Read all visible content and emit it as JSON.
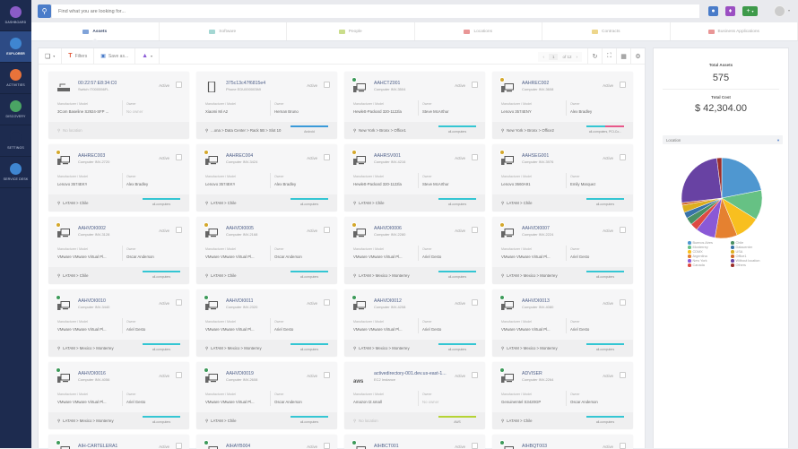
{
  "sidebar": {
    "items": [
      {
        "label": "Dashboard",
        "icon": "gauge-icon",
        "color": "#8b5cc7"
      },
      {
        "label": "Explorer",
        "icon": "globe-icon",
        "color": "#3f86d1",
        "active": true
      },
      {
        "label": "Activities",
        "icon": "clock-icon",
        "color": "#e8733a"
      },
      {
        "label": "Discovery",
        "icon": "list-icon",
        "color": "#4aa564"
      },
      {
        "label": "Settings",
        "icon": "gears-icon",
        "color": "#1d2b4f"
      },
      {
        "label": "Service Desk",
        "icon": "service-desk-icon",
        "color": "#3f86d1"
      }
    ]
  },
  "header": {
    "search_placeholder": "Find what you are looking for..."
  },
  "tabs": [
    {
      "label": "Assets",
      "active": true,
      "color": "#4a7cc9"
    },
    {
      "label": "Software",
      "color": "#7ec6c0"
    },
    {
      "label": "People",
      "color": "#b3cf5a"
    },
    {
      "label": "Locations",
      "color": "#e06a6a"
    },
    {
      "label": "Contracts",
      "color": "#e6c45a"
    },
    {
      "label": "Business Applications",
      "color": "#e06a6a"
    }
  ],
  "toolbar": {
    "filters": "Filters",
    "save_as": "Save as...",
    "pager": {
      "current": "1",
      "of": "of 12"
    }
  },
  "labels": {
    "active": "Active",
    "manufacturer": "Manufacturer / Model",
    "owner": "Owner"
  },
  "cards": [
    {
      "name": "00:22:57:E8:34:C0",
      "sub": "Switch IT000556FL",
      "type": "switch",
      "badge": "",
      "model": "3Com Baseline S2924-SFP ...",
      "owner": "No owner",
      "owner_muted": true,
      "location": "No location",
      "loc_muted": true,
      "tags": "",
      "tag_colors": []
    },
    {
      "name": "375c13c47f6815e4",
      "sub": "Phone EDU000003MI",
      "type": "phone",
      "badge": "",
      "model": "Xiaomi Mi A2",
      "owner": "Hernan Bruno",
      "location": "...ona > Data Center > Rack 5B > Slot 10",
      "tags": "Android",
      "tag_colors": [
        "#3a9ad9"
      ]
    },
    {
      "name": "AAHCTZ001",
      "sub": "Computer INV-3504",
      "type": "computer",
      "badge": "#3d9a5a",
      "model": "Hewlett-Packard 320-1122la",
      "owner": "Steve McArthur",
      "location": "New York > Bronx > Office1",
      "tags": "all-computers",
      "tag_colors": [
        "#34c6d3"
      ]
    },
    {
      "name": "AAHREC002",
      "sub": "Computer INV-3608",
      "type": "computer",
      "badge": "#d4a82c",
      "model": "Lenovo 3574ENY",
      "owner": "Alex Bradley",
      "location": "New York > Bronx > Office2",
      "tags": "all-computers, PCI-Co...",
      "tag_colors": [
        "#34c6d3",
        "#e8588a"
      ]
    },
    {
      "name": "AAHREC003",
      "sub": "Computer INV-2720",
      "type": "computer",
      "badge": "#d4a82c",
      "model": "Lenovo 3574EKY",
      "owner": "Alex Bradley",
      "location": "LATAM > Chile",
      "tags": "all-computers",
      "tag_colors": [
        "#34c6d3"
      ]
    },
    {
      "name": "AAHREC004",
      "sub": "Computer INV-3424",
      "type": "computer",
      "badge": "#d4a82c",
      "model": "Lenovo 3574EKY",
      "owner": "Alex Bradley",
      "location": "LATAM > Chile",
      "tags": "all-computers",
      "tag_colors": [
        "#34c6d3"
      ]
    },
    {
      "name": "AAHRSV001",
      "sub": "Computer INV-4216",
      "type": "computer",
      "badge": "#d4a82c",
      "model": "Hewlett-Packard 320-1122la",
      "owner": "Steve McArthur",
      "location": "LATAM > Chile",
      "tags": "all-computers",
      "tag_colors": [
        "#34c6d3"
      ]
    },
    {
      "name": "AAHSEG001",
      "sub": "Computer INV-3976",
      "type": "computer",
      "badge": "#d4a82c",
      "model": "Lenovo 3660A91",
      "owner": "Emily Marquez",
      "location": "LATAM > Chile",
      "tags": "all-computers",
      "tag_colors": [
        "#34c6d3"
      ]
    },
    {
      "name": "AAHVDI0002",
      "sub": "Computer INV-3128",
      "type": "computer",
      "badge": "#d4a82c",
      "model": "VMware VMware Virtual Pl...",
      "owner": "Oscar Anderson",
      "location": "LATAM > Chile",
      "tags": "all-computers",
      "tag_colors": [
        "#34c6d3"
      ]
    },
    {
      "name": "AAHVDI0005",
      "sub": "Computer INV-2168",
      "type": "computer",
      "badge": "#d4a82c",
      "model": "VMware VMware Virtual Pl...",
      "owner": "Oscar Anderson",
      "location": "LATAM > Chile",
      "tags": "all-computers",
      "tag_colors": [
        "#34c6d3"
      ]
    },
    {
      "name": "AAHVDI0006",
      "sub": "Computer INV-2280",
      "type": "computer",
      "badge": "#d4a82c",
      "model": "VMware VMware Virtual Pl...",
      "owner": "Ariel Gesto",
      "location": "LATAM > Mexico > Monterrey",
      "tags": "all-computers",
      "tag_colors": [
        "#34c6d3"
      ]
    },
    {
      "name": "AAHVDI0007",
      "sub": "Computer INV-2224",
      "type": "computer",
      "badge": "#d4a82c",
      "model": "VMware VMware Virtual Pl...",
      "owner": "Ariel Gesto",
      "location": "LATAM > Mexico > Monterrey",
      "tags": "all-computers",
      "tag_colors": [
        "#34c6d3"
      ]
    },
    {
      "name": "AAHVDI0010",
      "sub": "Computer INV-3440",
      "type": "computer",
      "badge": "#3d9a5a",
      "model": "VMware VMware Virtual Pl...",
      "owner": "Ariel Gesto",
      "location": "LATAM > Mexico > Monterrey",
      "tags": "all-computers",
      "tag_colors": [
        "#34c6d3"
      ]
    },
    {
      "name": "AAHVDI0011",
      "sub": "Computer INV-2320",
      "type": "computer",
      "badge": "#3d9a5a",
      "model": "VMware VMware Virtual Pl...",
      "owner": "Ariel Gesto",
      "location": "LATAM > Mexico > Monterrey",
      "tags": "all-computers",
      "tag_colors": [
        "#34c6d3"
      ]
    },
    {
      "name": "AAHVDI0012",
      "sub": "Computer INV-4208",
      "type": "computer",
      "badge": "#3d9a5a",
      "model": "VMware VMware Virtual Pl...",
      "owner": "Ariel Gesto",
      "location": "LATAM > Mexico > Monterrey",
      "tags": "all-computers",
      "tag_colors": [
        "#34c6d3"
      ]
    },
    {
      "name": "AAHVDI0013",
      "sub": "Computer INV-4080",
      "type": "computer",
      "badge": "#3d9a5a",
      "model": "VMware VMware Virtual Pl...",
      "owner": "Ariel Gesto",
      "location": "LATAM > Mexico > Monterrey",
      "tags": "all-computers",
      "tag_colors": [
        "#34c6d3"
      ]
    },
    {
      "name": "AAHVDI0016",
      "sub": "Computer INV-4056",
      "type": "computer",
      "badge": "#3d9a5a",
      "model": "VMware VMware Virtual Pl...",
      "owner": "Ariel Gesto",
      "location": "LATAM > Mexico > Monterrey",
      "tags": "all-computers",
      "tag_colors": [
        "#34c6d3"
      ]
    },
    {
      "name": "AAHVDI0019",
      "sub": "Computer INV-2608",
      "type": "computer",
      "badge": "#3d9a5a",
      "model": "VMware VMware Virtual Pl...",
      "owner": "Oscar Anderson",
      "location": "LATAM > Chile",
      "tags": "all-computers",
      "tag_colors": [
        "#34c6d3"
      ]
    },
    {
      "name": "activedirectory-001.dev.us-east-1...",
      "sub": "EC2 Instance",
      "type": "aws",
      "badge": "",
      "model": "Amazon t2.small",
      "owner": "No owner",
      "owner_muted": true,
      "location": "No location",
      "loc_muted": true,
      "tags": "AWS",
      "tag_colors": [
        "#b5d334"
      ]
    },
    {
      "name": "ADVISER",
      "sub": "Computer INV-2264",
      "type": "computer",
      "badge": "#3d9a5a",
      "model": "GenuineIntel S3420GP",
      "owner": "Oscar Anderson",
      "location": "LATAM > Chile",
      "tags": "all-computers",
      "tag_colors": [
        "#34c6d3"
      ]
    },
    {
      "name": "AIH-CARTELERA1",
      "sub": "",
      "type": "computer",
      "badge": "#3d9a5a",
      "partial": true
    },
    {
      "name": "AIHAYB004",
      "sub": "",
      "type": "computer",
      "badge": "#3d9a5a",
      "partial": true
    },
    {
      "name": "AIHBCT001",
      "sub": "",
      "type": "computer",
      "badge": "#3d9a5a",
      "partial": true
    },
    {
      "name": "AIHBQT003",
      "sub": "",
      "type": "computer",
      "badge": "#3d9a5a",
      "partial": true
    }
  ],
  "summary": {
    "total_assets_label": "Total Assets",
    "total_assets": "575",
    "total_cost_label": "Total Cost",
    "total_cost": "$ 42,304.00",
    "group_by": "Location"
  },
  "chart_data": {
    "type": "pie",
    "title": "Location",
    "slices": [
      {
        "label": "Buenos Aires",
        "value": 22,
        "color": "#4f97d0"
      },
      {
        "label": "Monterrey",
        "value": 12,
        "color": "#66c184"
      },
      {
        "label": "CDMX",
        "value": 10,
        "color": "#f8bf1f"
      },
      {
        "label": "Argentina",
        "value": 9,
        "color": "#e58130"
      },
      {
        "label": "New York",
        "value": 8,
        "color": "#8a59d6"
      },
      {
        "label": "Canada",
        "value": 3,
        "color": "#de4a43"
      },
      {
        "label": "Chile",
        "value": 3,
        "color": "#4a9063"
      },
      {
        "label": "Datacenter",
        "value": 2.5,
        "color": "#3873a8"
      },
      {
        "label": "USA",
        "value": 3,
        "color": "#dcae1f"
      },
      {
        "label": "Office1",
        "value": 1,
        "color": "#d26a28"
      },
      {
        "label": "Without location",
        "value": 25,
        "color": "#6842a3"
      },
      {
        "label": "Others",
        "value": 2,
        "color": "#9b2f2b"
      }
    ],
    "legend_order": [
      "Buenos Aires",
      "Monterrey",
      "CDMX",
      "Argentina",
      "New York",
      "Canada",
      "Chile",
      "Datacenter",
      "USA",
      "Office1",
      "Without location",
      "Others"
    ]
  }
}
